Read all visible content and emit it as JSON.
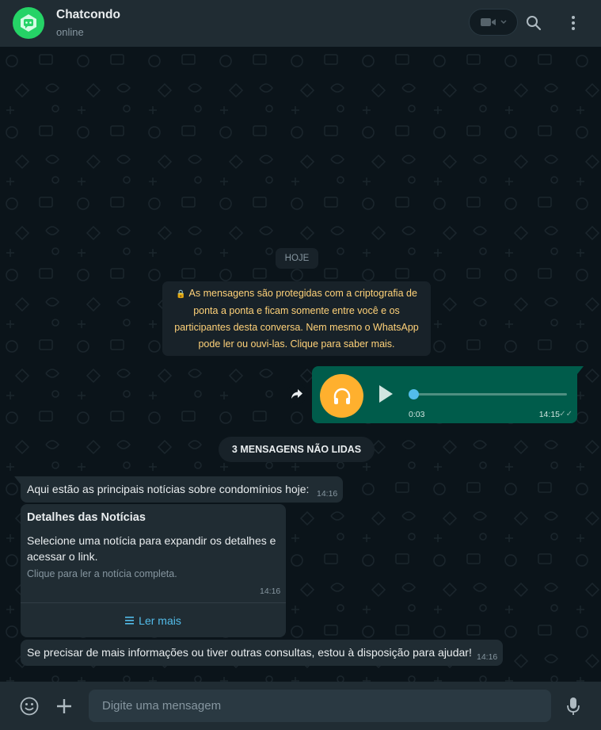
{
  "header": {
    "contact_name": "Chatcondo",
    "status": "online",
    "icons": [
      "avatar-logo",
      "video-call-icon",
      "search-icon",
      "more-options-icon"
    ]
  },
  "chat": {
    "date_chip": "HOJE",
    "encryption_notice": "As mensagens são protegidas com a criptografia de ponta a ponta e ficam somente entre você e os participantes desta conversa. Nem mesmo o WhatsApp pode ler ou ouvi-las. Clique para saber mais.",
    "audio_message": {
      "duration": "0:03",
      "time": "14:15",
      "progress": 0.0
    },
    "unread_chip": "3 MENSAGENS NÃO LIDAS",
    "messages": [
      {
        "text": "Aqui estão as principais notícias sobre condomínios hoje:",
        "time": "14:16"
      },
      {
        "title": "Detalhes das Notícias",
        "body": "Selecione uma notícia para expandir os detalhes e acessar o link.",
        "hint": "Clique para ler a notícia completa.",
        "time": "14:16",
        "action_label": "Ler mais"
      },
      {
        "text": "Se precisar de mais informações ou tiver outras consultas, estou à disposição para ajudar!",
        "time": "14:16"
      }
    ]
  },
  "composer": {
    "placeholder": "Digite uma mensagem"
  },
  "colors": {
    "header_bg": "#202c33",
    "chat_bg": "#0b141a",
    "outgoing_bubble": "#005c4b",
    "incoming_bubble": "#202c33",
    "accent_green": "#25d366",
    "notice_text": "#ffd279",
    "link": "#53bdeb",
    "audio_avatar": "#ffb02e"
  }
}
